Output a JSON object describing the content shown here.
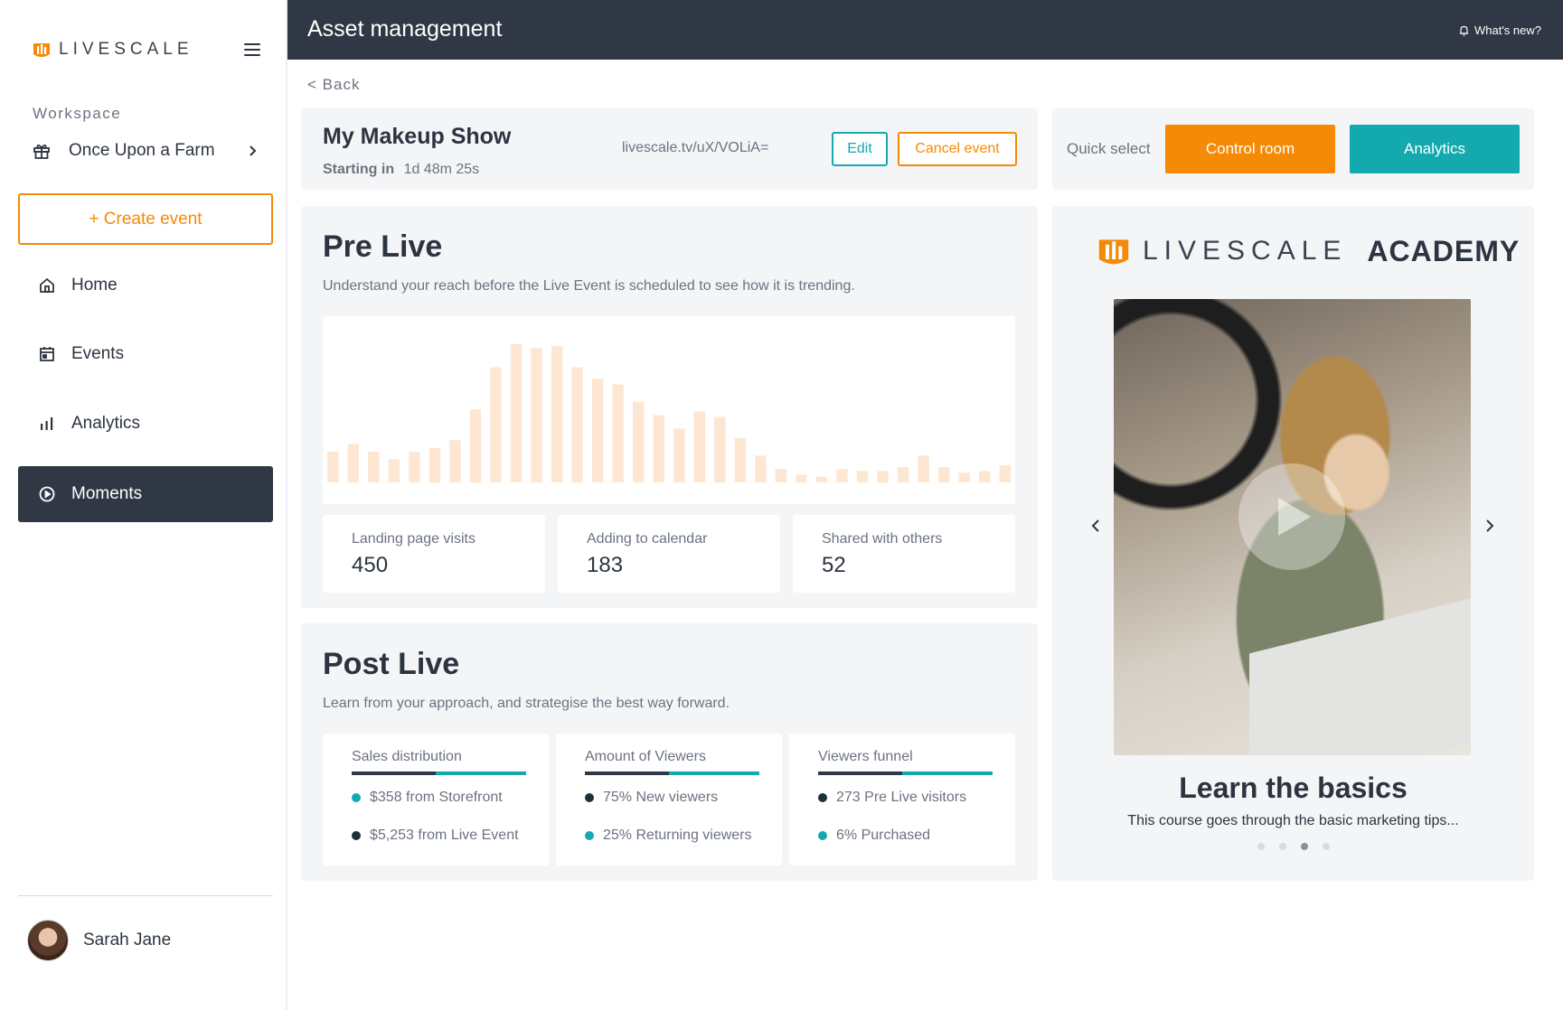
{
  "sidebar": {
    "logo_text": "LIVESCALE",
    "workspace_label": "Workspace",
    "workspace_name": "Once Upon a Farm",
    "create_event": "+ Create event",
    "nav": [
      {
        "label": "Home",
        "icon": "home-icon"
      },
      {
        "label": "Events",
        "icon": "calendar-icon"
      },
      {
        "label": "Analytics",
        "icon": "bar-chart-icon"
      },
      {
        "label": "Moments",
        "icon": "play-circle-icon",
        "active": true
      }
    ],
    "user_name": "Sarah Jane"
  },
  "topbar": {
    "title": "Asset management",
    "whats_new": "What's new?"
  },
  "back_label": "< Back",
  "event": {
    "title": "My Makeup Show",
    "starting_label": "Starting in",
    "starting_value": "1d 48m 25s",
    "url": "livescale.tv/uX/VOLiA=",
    "edit_label": "Edit",
    "cancel_label": "Cancel event"
  },
  "quick_select": {
    "label": "Quick select",
    "control_room": "Control room",
    "analytics": "Analytics"
  },
  "pre_live": {
    "title": "Pre Live",
    "subtitle": "Understand your reach before the Live Event is scheduled to see how it is trending.",
    "stats": [
      {
        "label": "Landing page visits",
        "value": "450"
      },
      {
        "label": "Adding to calendar",
        "value": "183"
      },
      {
        "label": "Shared with others",
        "value": "52"
      }
    ]
  },
  "chart_data": {
    "type": "bar",
    "values": [
      16,
      20,
      16,
      12,
      16,
      18,
      22,
      38,
      60,
      72,
      70,
      71,
      60,
      54,
      51,
      42,
      35,
      28,
      37,
      34,
      23,
      14,
      7,
      4,
      3,
      7,
      6,
      6,
      8,
      14,
      8,
      5,
      6,
      9
    ],
    "color": "#fde7d2",
    "ylim": [
      0,
      80
    ]
  },
  "post_live": {
    "title": "Post Live",
    "subtitle": "Learn from your approach, and strategise the best way forward.",
    "cards": [
      {
        "title": "Sales distribution",
        "lines": [
          {
            "text": "$358 from Storefront",
            "color": "#14a9ae"
          },
          {
            "text": "$5,253 from Live Event",
            "color": "#1e3038"
          }
        ]
      },
      {
        "title": "Amount of Viewers",
        "lines": [
          {
            "text": "75% New viewers",
            "color": "#1e3038"
          },
          {
            "text": "25% Returning viewers",
            "color": "#14a9ae"
          }
        ]
      },
      {
        "title": "Viewers funnel",
        "lines": [
          {
            "text": "273 Pre Live visitors",
            "color": "#1e3038"
          },
          {
            "text": "6% Purchased",
            "color": "#14a9ae"
          }
        ]
      }
    ]
  },
  "academy": {
    "logo_text": "LIVESCALE",
    "academy_word": "ACADEMY",
    "learn_title": "Learn the basics",
    "learn_sub": "This course goes through the basic marketing tips..."
  },
  "colors": {
    "orange": "#f58a07",
    "teal": "#14a9ae",
    "dark": "#2f3844"
  }
}
